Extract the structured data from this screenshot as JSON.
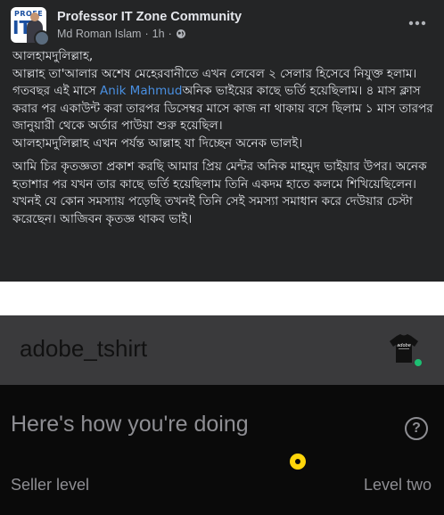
{
  "post": {
    "group_name": "Professor IT Zone Community",
    "author": "Md Roman Islam",
    "separator": "·",
    "time": "1h",
    "separator2": "·",
    "avatar_logo_top": "PROFE",
    "avatar_logo_main": "IT",
    "body": {
      "p1_line1": "আলহামদুলিল্লাহ,",
      "p1_line2": "আল্লাহ তা'আলার অশেষ মেহেরবানীতে এখন লেবেল ২ সেলার হিসেবে নিযুক্ত হলাম।",
      "p1_line3_before": "গতবছর এই মাসে ",
      "p1_mention": "Anik Mahmud",
      "p1_line3_after": "অনিক ভাইয়ের কাছে ভর্তি হয়েছিলাম। ৪ মাস ক্লাস করার পর একাউন্ট করা তারপর ডিসেম্বর মাসে কাজ না থাকায় বসে ছিলাম ১ মাস তারপর জানুয়ারী থেকে অর্ডার পাউয়া শুরু হয়েছিল।",
      "p1_line4": "আলহামদুলিল্লাহ এখন পর্যন্ত আল্লাহ যা দিচ্ছেন অনেক ভালই।",
      "p2": "আমি চির কৃতজ্ঞতা প্রকাশ করছি আমার প্রিয় মেন্টর অনিক মাহমুদ ভাইয়ার উপর। অনেক হতাশার পর যখন তার কাছে ভর্তি হয়েছিলাম তিনি একদম হাতে কলমে শিখিয়েছিলেন। যখনই যে কোন সমস্যায় পড়েছি তখনই তিনি সেই সমস্যা সমাধান করে দেউয়ার চেস্টা করেছেন। আজিবন কৃতজ্ঞ থাকব ভাই।"
    }
  },
  "fiverr": {
    "username": "adobe_tshirt",
    "heading": "Here's how you're doing",
    "help_symbol": "?",
    "seller_level_label": "Seller level",
    "seller_level_value": "Level two",
    "tshirt_text": "adobe"
  },
  "icons": {
    "more": "more-horizontal-icon",
    "globe": "globe-icon",
    "help": "help-circle-icon"
  },
  "colors": {
    "fb_background": "#242526",
    "mention": "#4a90e2",
    "fiverr_online": "#1dbf73",
    "level_marker": "#ffd60a"
  }
}
